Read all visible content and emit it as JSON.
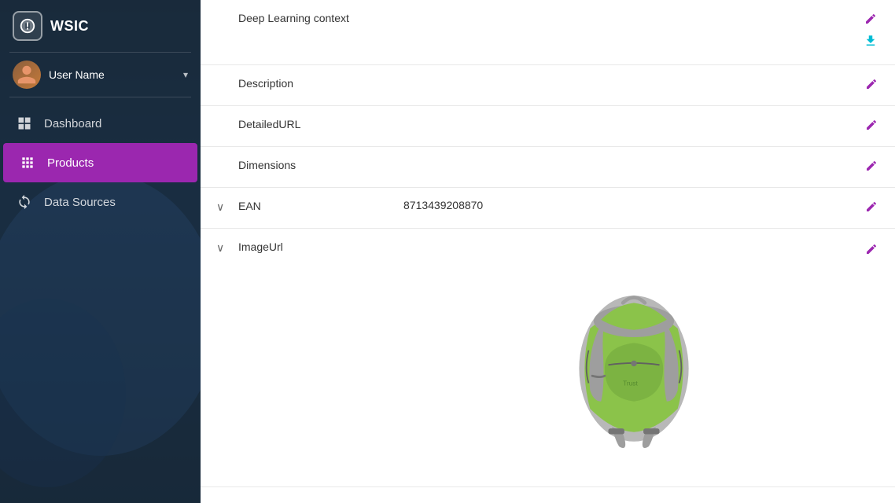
{
  "app": {
    "title": "WSIC"
  },
  "user": {
    "name": "User Name"
  },
  "nav": {
    "items": [
      {
        "id": "dashboard",
        "label": "Dashboard",
        "icon": "grid-icon",
        "active": false
      },
      {
        "id": "products",
        "label": "Products",
        "icon": "apps-icon",
        "active": true
      },
      {
        "id": "datasources",
        "label": "Data Sources",
        "icon": "sync-icon",
        "active": false
      }
    ]
  },
  "fields": [
    {
      "id": "deep-learning",
      "name": "Deep Learning context",
      "value": "",
      "expandable": false,
      "hasDownload": true
    },
    {
      "id": "description",
      "name": "Description",
      "value": "",
      "expandable": false,
      "hasDownload": false
    },
    {
      "id": "detailed-url",
      "name": "DetailedURL",
      "value": "",
      "expandable": false,
      "hasDownload": false
    },
    {
      "id": "dimensions",
      "name": "Dimensions",
      "value": "",
      "expandable": false,
      "hasDownload": false
    },
    {
      "id": "ean",
      "name": "EAN",
      "value": "8713439208870",
      "expandable": true,
      "hasDownload": false
    },
    {
      "id": "image-url",
      "name": "ImageUrl",
      "value": "",
      "expandable": true,
      "hasDownload": false
    }
  ],
  "icons": {
    "pencil": "✎",
    "download": "⬇",
    "chevron_right": "›",
    "chevron_down": "˅",
    "expand": "∨"
  }
}
